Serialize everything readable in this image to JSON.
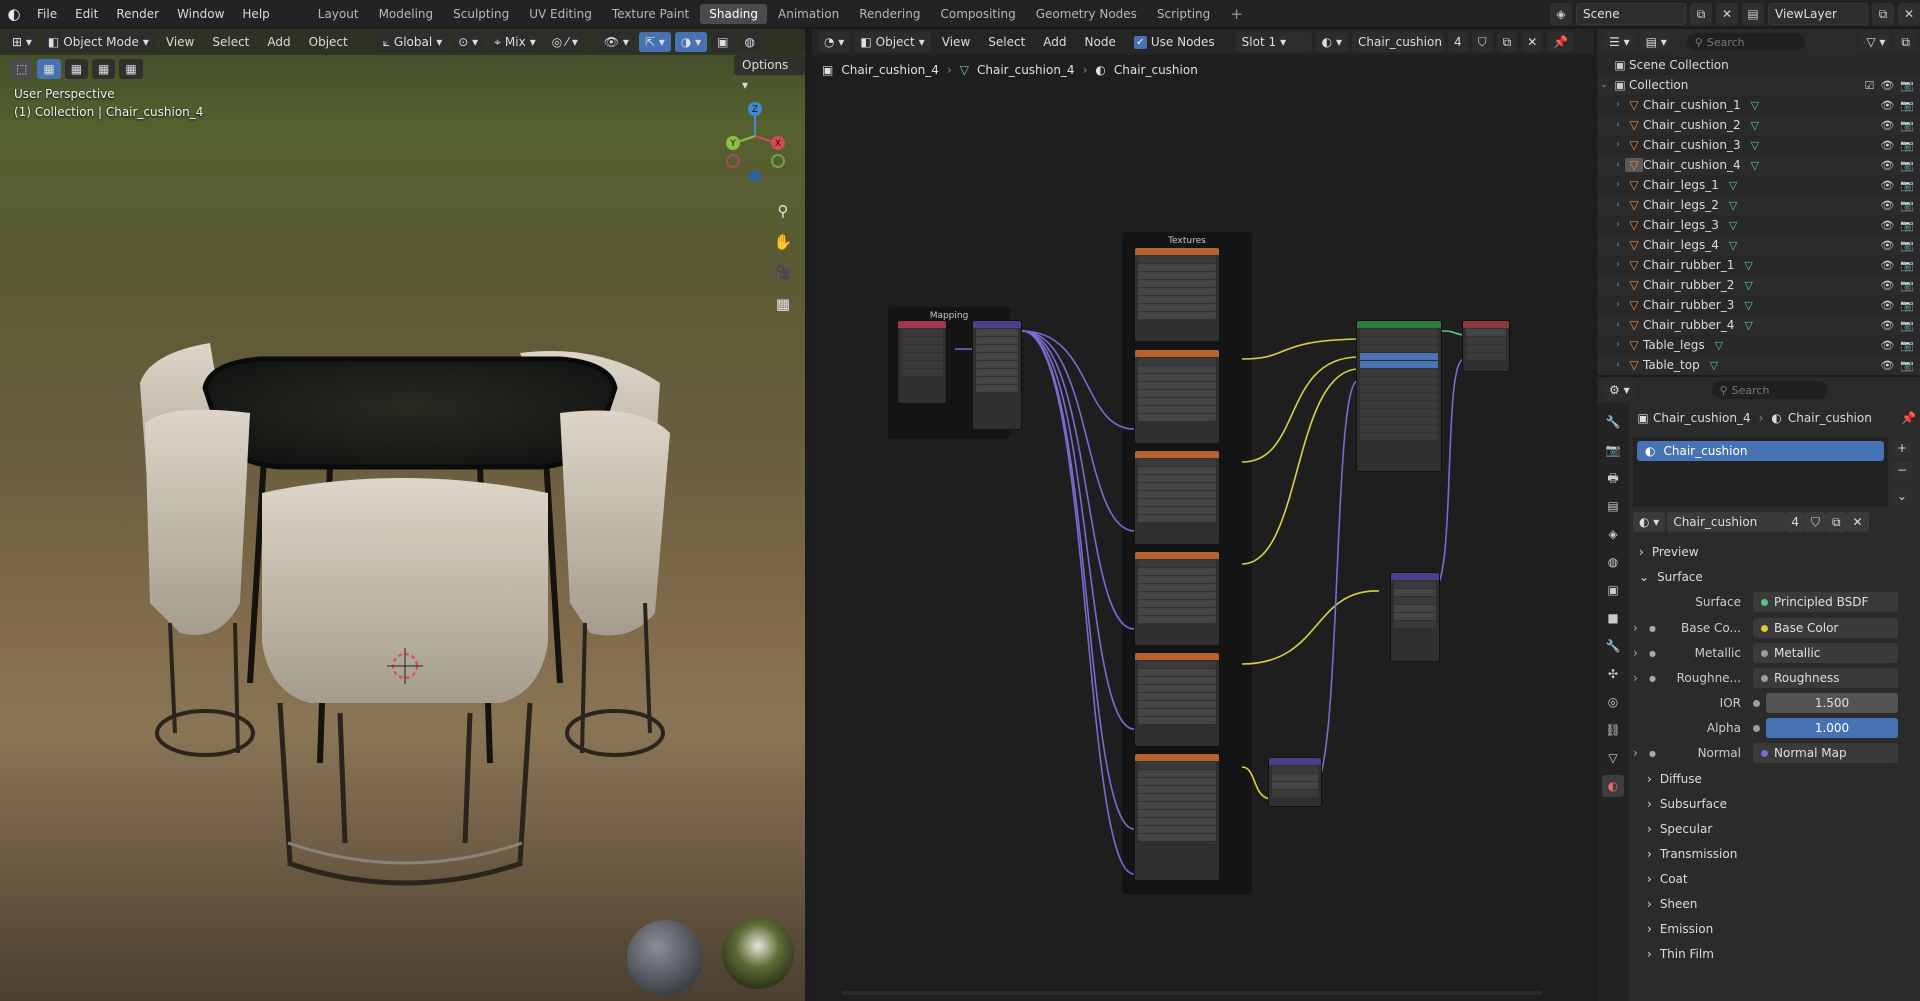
{
  "menu": [
    "File",
    "Edit",
    "Render",
    "Window",
    "Help"
  ],
  "workspaces": [
    "Layout",
    "Modeling",
    "Sculpting",
    "UV Editing",
    "Texture Paint",
    "Shading",
    "Animation",
    "Rendering",
    "Compositing",
    "Geometry Nodes",
    "Scripting"
  ],
  "active_workspace": "Shading",
  "scene": "Scene",
  "view_layer": "ViewLayer",
  "viewport": {
    "mode": "Object Mode",
    "menus": [
      "View",
      "Select",
      "Add",
      "Object"
    ],
    "transform": "Global",
    "snap_mix": "Mix",
    "options": "Options",
    "perspective": "User Perspective",
    "collection_info": "(1) Collection | Chair_cushion_4",
    "axes": {
      "x": "X",
      "y": "Y",
      "z": "Z"
    }
  },
  "node_editor": {
    "type": "Object",
    "menus": [
      "View",
      "Select",
      "Add",
      "Node"
    ],
    "use_nodes": "Use Nodes",
    "slot": "Slot 1",
    "material": "Chair_cushion",
    "users": "4",
    "breadcrumb": [
      "Chair_cushion_4",
      "Chair_cushion_4",
      "Chair_cushion"
    ],
    "frame_mapping": "Mapping",
    "frame_textures": "Textures"
  },
  "outliner": {
    "search_placeholder": "Search",
    "scene_collection": "Scene Collection",
    "collection": "Collection",
    "items": [
      "Chair_cushion_1",
      "Chair_cushion_2",
      "Chair_cushion_3",
      "Chair_cushion_4",
      "Chair_legs_1",
      "Chair_legs_2",
      "Chair_legs_3",
      "Chair_legs_4",
      "Chair_rubber_1",
      "Chair_rubber_2",
      "Chair_rubber_3",
      "Chair_rubber_4",
      "Table_legs",
      "Table_top"
    ],
    "selected": "Chair_cushion_4"
  },
  "properties": {
    "search_placeholder": "Search",
    "breadcrumb": [
      "Chair_cushion_4",
      "Chair_cushion"
    ],
    "slot_name": "Chair_cushion",
    "material_name": "Chair_cushion",
    "material_users": "4",
    "preview": "Preview",
    "surface_panel": "Surface",
    "surface_label": "Surface",
    "surface_value": "Principled BSDF",
    "inputs": [
      {
        "label": "Base Co...",
        "value": "Base Color",
        "dot": "#e3c53a"
      },
      {
        "label": "Metallic",
        "value": "Metallic",
        "dot": "#9e9e9e"
      },
      {
        "label": "Roughne...",
        "value": "Roughness",
        "dot": "#9e9e9e"
      }
    ],
    "ior_label": "IOR",
    "ior_value": "1.500",
    "alpha_label": "Alpha",
    "alpha_value": "1.000",
    "normal_label": "Normal",
    "normal_value": "Normal Map",
    "subpanels": [
      "Diffuse",
      "Subsurface",
      "Specular",
      "Transmission",
      "Coat",
      "Sheen",
      "Emission",
      "Thin Film"
    ]
  },
  "colors": {
    "accent": "#4772b3",
    "object": "#ef8a3a",
    "mesh": "#61c38c",
    "link_yellow": "#d8d242",
    "link_purple": "#7a6bd0"
  }
}
